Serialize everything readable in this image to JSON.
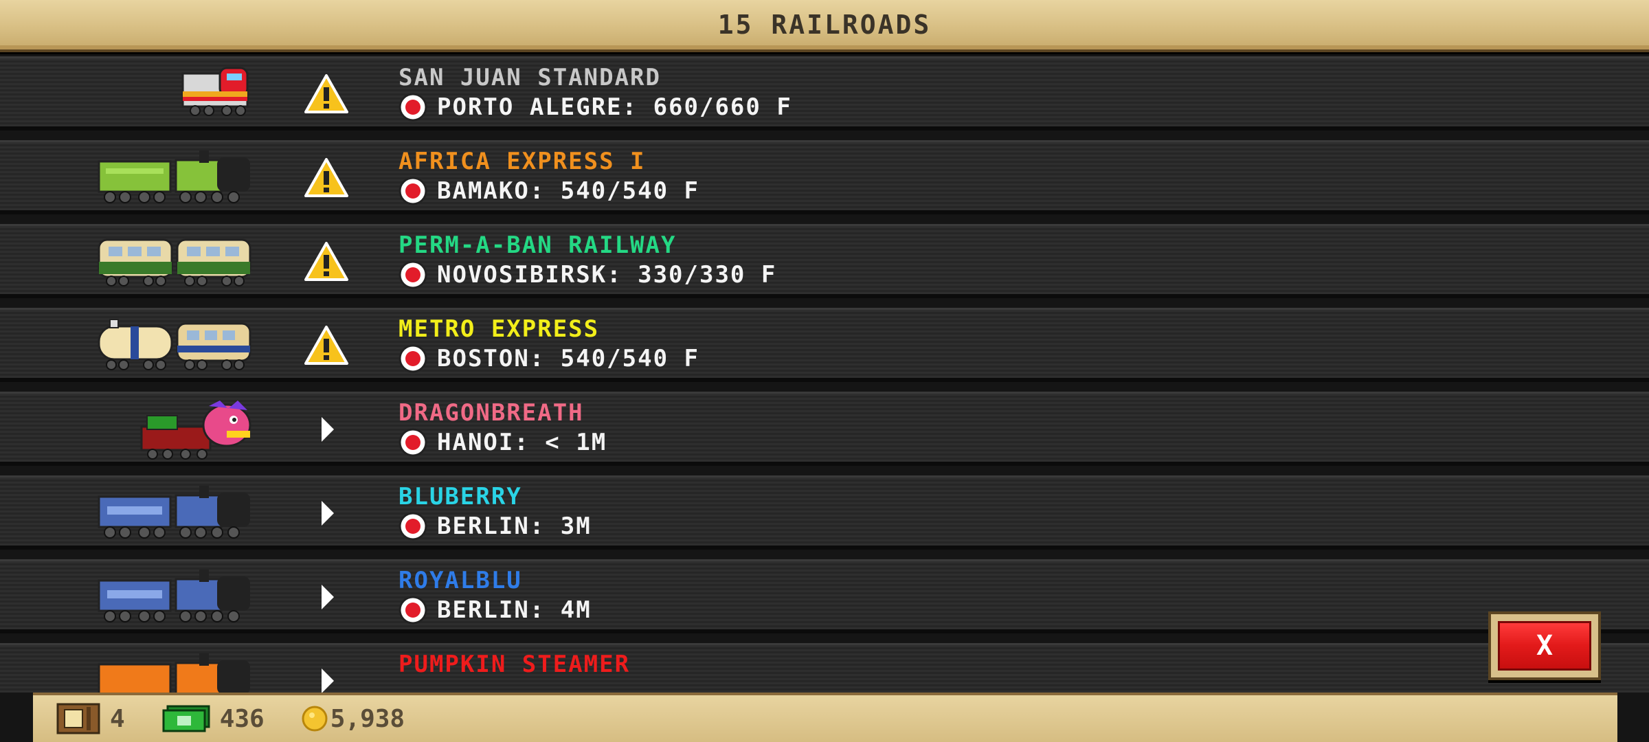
{
  "header": {
    "title": "15 RAILROADS"
  },
  "railroads": [
    {
      "name": "SAN JUAN STANDARD",
      "name_color": "#c8c8c8",
      "status": "warning-icon",
      "info": "PORTO ALEGRE: 660/660 F"
    },
    {
      "name": "AFRICA EXPRESS I",
      "name_color": "#f0901e",
      "status": "warning-icon",
      "info": "BAMAKO: 540/540 F"
    },
    {
      "name": "PERM-A-BAN RAILWAY",
      "name_color": "#24d884",
      "status": "warning-icon",
      "info": "NOVOSIBIRSK: 330/330 F"
    },
    {
      "name": "METRO EXPRESS",
      "name_color": "#f2ee1a",
      "status": "warning-icon",
      "info": "BOSTON: 540/540 F"
    },
    {
      "name": "DRAGONBREATH",
      "name_color": "#f06a86",
      "status": "play-arrow-icon",
      "info": "HANOI: < 1M"
    },
    {
      "name": "BLUBERRY",
      "name_color": "#2ad4e6",
      "status": "play-arrow-icon",
      "info": "BERLIN: 3M"
    },
    {
      "name": "ROYALBLU",
      "name_color": "#2f7ce8",
      "status": "play-arrow-icon",
      "info": "BERLIN: 4M"
    },
    {
      "name": "PUMPKIN STEAMER",
      "name_color": "#ee1c1c",
      "status": "play-arrow-icon",
      "info": ""
    }
  ],
  "close_button": {
    "label": "X"
  },
  "footer": {
    "boxes": "4",
    "cash": "436",
    "coins": "5,938"
  }
}
